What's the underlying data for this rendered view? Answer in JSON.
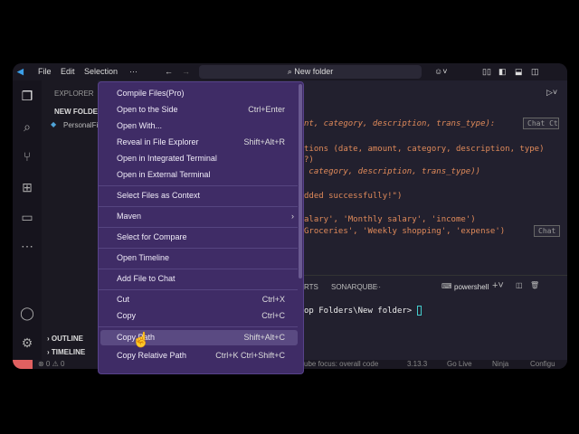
{
  "titlebar": {
    "menus": [
      "File",
      "Edit",
      "Selection",
      "···"
    ],
    "search": "New folder"
  },
  "sidebar": {
    "title": "EXPLORER",
    "folder": "NEW FOLDER",
    "file": "PersonalFi",
    "outline": "OUTLINE",
    "timeline": "TIMELINE"
  },
  "menu": {
    "items": [
      {
        "label": "Compile Files(Pro)",
        "shortcut": ""
      },
      {
        "label": "Open to the Side",
        "shortcut": "Ctrl+Enter"
      },
      {
        "label": "Open With...",
        "shortcut": ""
      },
      {
        "label": "Reveal in File Explorer",
        "shortcut": "Shift+Alt+R"
      },
      {
        "label": "Open in Integrated Terminal",
        "shortcut": ""
      },
      {
        "label": "Open in External Terminal",
        "shortcut": ""
      },
      {
        "label": "Select Files as Context",
        "shortcut": ""
      },
      {
        "label": "Maven",
        "shortcut": "›"
      },
      {
        "label": "Select for Compare",
        "shortcut": ""
      },
      {
        "label": "Open Timeline",
        "shortcut": ""
      },
      {
        "label": "Add File to Chat",
        "shortcut": ""
      },
      {
        "label": "Cut",
        "shortcut": "Ctrl+X"
      },
      {
        "label": "Copy",
        "shortcut": "Ctrl+C"
      },
      {
        "label": "Copy Path",
        "shortcut": "Shift+Alt+C"
      },
      {
        "label": "Copy Relative Path",
        "shortcut": "Ctrl+K Ctrl+Shift+C"
      }
    ]
  },
  "editor": {
    "lines": [
      "nt, category, description, trans_type):",
      "tions (date, amount, category, description, type)",
      "?)",
      " category, description, trans_type))",
      "dded successfully!\")",
      "alary', 'Monthly salary', 'income')",
      "Groceries', 'Weekly shopping', 'expense')"
    ],
    "chat": "Chat Ctrl+I",
    "chat2": "Chat"
  },
  "panel": {
    "tabs": [
      "RTS",
      "SONARQUBE",
      "···"
    ],
    "shell": "powershell",
    "prompt": "op Folders\\New folder> "
  },
  "status": {
    "problems": "⊗ 0 ⚠ 0",
    "focus": "ube focus: overall code",
    "version": "3.13.3",
    "golive": "Go Live",
    "ninja": "Ninja",
    "config": "Configu"
  }
}
